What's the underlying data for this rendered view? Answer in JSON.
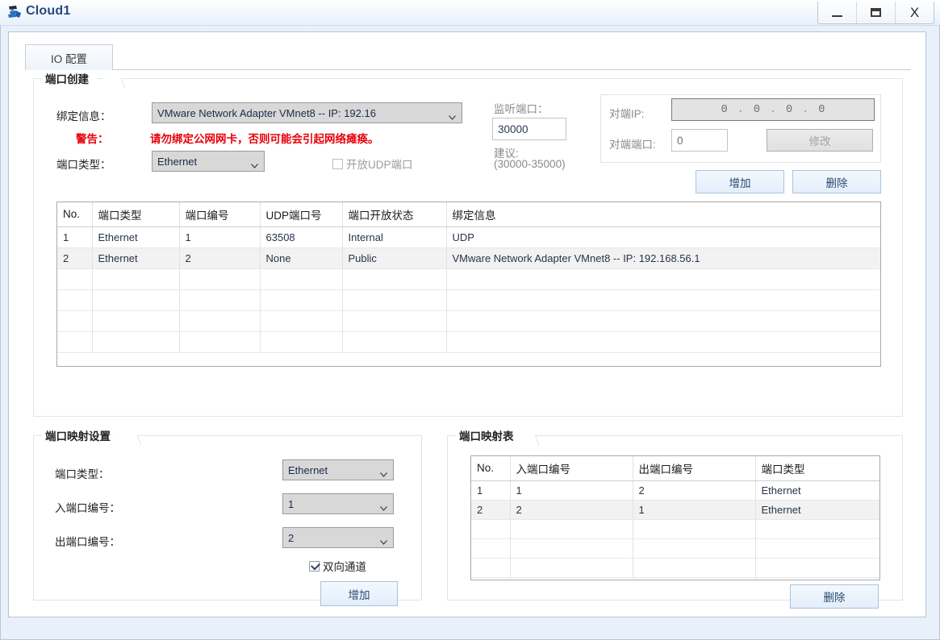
{
  "window": {
    "title": "Cloud1",
    "icon": "cloud-network-icon",
    "controls": {
      "minimize": "minimize-icon",
      "maximize": "maximize-icon",
      "close": "X"
    }
  },
  "tabs": [
    {
      "label": "IO 配置",
      "selected": true
    }
  ],
  "port_create": {
    "title": "端口创建",
    "bind_info_label": "绑定信息：",
    "bind_info_value": "VMware Network Adapter VMnet8 -- IP: 192.16",
    "warning_label": "警告：",
    "warning_text": "请勿绑定公网网卡，否则可能会引起网络瘫痪。",
    "warning_color": "#e8000a",
    "port_type_label": "端口类型：",
    "port_type_value": "Ethernet",
    "udp_checkbox_label": "开放UDP端口",
    "udp_checked": false,
    "udp_disabled": true,
    "listen_port_label": "监听端口：",
    "listen_port_value": "30000",
    "suggest_label": "建议:",
    "suggest_range": "(30000-35000)",
    "peer_ip_label": "对端IP:",
    "peer_ip_octets": [
      "0",
      "0",
      "0",
      "0"
    ],
    "peer_port_label": "对端端口:",
    "peer_port_value": "0",
    "modify_button": "修改",
    "modify_disabled": true,
    "add_button": "增加",
    "delete_button": "删除"
  },
  "port_table": {
    "columns": [
      "No.",
      "端口类型",
      "端口编号",
      "UDP端口号",
      "端口开放状态",
      "绑定信息"
    ],
    "rows": [
      [
        "1",
        "Ethernet",
        "1",
        "63508",
        "Internal",
        "UDP"
      ],
      [
        "2",
        "Ethernet",
        "2",
        "None",
        "Public",
        "VMware Network Adapter VMnet8 -- IP: 192.168.56.1"
      ]
    ],
    "empty_rows": 4,
    "selected_row_index": 1
  },
  "mapping_settings": {
    "title": "端口映射设置",
    "port_type_label": "端口类型：",
    "port_type_value": "Ethernet",
    "in_port_label": "入端口编号：",
    "in_port_value": "1",
    "out_port_label": "出端口编号：",
    "out_port_value": "2",
    "bidirectional_label": "双向通道",
    "bidirectional_checked": true,
    "add_button": "增加"
  },
  "mapping_table": {
    "title": "端口映射表",
    "columns": [
      "No.",
      "入端口编号",
      "出端口编号",
      "端口类型"
    ],
    "rows": [
      [
        "1",
        "1",
        "2",
        "Ethernet"
      ],
      [
        "2",
        "2",
        "1",
        "Ethernet"
      ]
    ],
    "empty_rows": 3,
    "selected_row_index": 1,
    "delete_button": "删除"
  }
}
